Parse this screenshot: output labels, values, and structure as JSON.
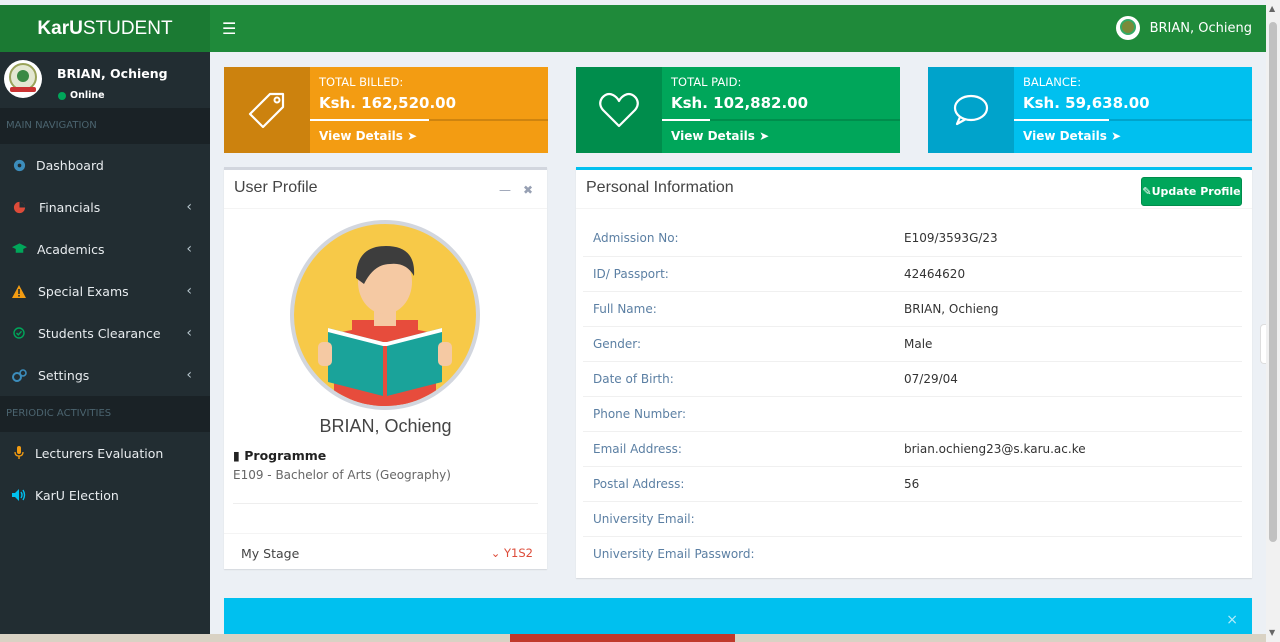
{
  "header": {
    "brand_bold": "KarU",
    "brand_rest": "STUDENT",
    "menu_icon": "hamburger-icon",
    "user_name": "BRIAN, Ochieng"
  },
  "sidebar": {
    "user_name": "BRIAN, Ochieng",
    "status": "Online",
    "main_header": "MAIN NAVIGATION",
    "items": [
      {
        "label": "Dashboard",
        "icon": "dashboard-icon",
        "color": "#3c8dbc"
      },
      {
        "label": "Financials",
        "icon": "pie-chart-icon",
        "color": "#dd4b39"
      },
      {
        "label": "Academics",
        "icon": "graduation-cap-icon",
        "color": "#00a65a"
      },
      {
        "label": "Special Exams",
        "icon": "warning-icon",
        "color": "#f39c12"
      },
      {
        "label": "Students Clearance",
        "icon": "check-circle-icon",
        "color": "#00a65a"
      },
      {
        "label": "Settings",
        "icon": "cogs-icon",
        "color": "#3c8dbc"
      }
    ],
    "periodic_header": "PERIODIC ACTIVITIES",
    "periodic_items": [
      {
        "label": "Lecturers Evaluation",
        "icon": "microphone-icon",
        "color": "#f39c12"
      },
      {
        "label": "KarU Election",
        "icon": "volume-icon",
        "color": "#00c0ef"
      }
    ]
  },
  "info_boxes": [
    {
      "label": "TOTAL BILLED:",
      "amount": "Ksh. 162,520.00",
      "link": "View Details",
      "icon": "tag-icon",
      "color": "#f39c12",
      "progress": 0.5
    },
    {
      "label": "TOTAL PAID:",
      "amount": "Ksh. 102,882.00",
      "link": "View Details",
      "icon": "heart-icon",
      "color": "#00a65a",
      "progress": 0.2
    },
    {
      "label": "BALANCE:",
      "amount": "Ksh. 59,638.00",
      "link": "View Details",
      "icon": "comment-icon",
      "color": "#00c0ef",
      "progress": 0.4
    }
  ],
  "profile": {
    "title": "User Profile",
    "name": "BRIAN, Ochieng",
    "programme_label": "Programme",
    "programme_value": "E109 - Bachelor of Arts (Geography)",
    "stage_label": "My Stage",
    "stage_value": "Y1S2"
  },
  "personal": {
    "title": "Personal Information",
    "update_button": "Update Profile",
    "rows": [
      {
        "key": "Admission No:",
        "value": "E109/3593G/23"
      },
      {
        "key": "ID/ Passport:",
        "value": "42464620"
      },
      {
        "key": "Full Name:",
        "value": "BRIAN, Ochieng"
      },
      {
        "key": "Gender:",
        "value": "Male"
      },
      {
        "key": "Date of Birth:",
        "value": "07/29/04"
      },
      {
        "key": "Phone Number:",
        "value": ""
      },
      {
        "key": "Email Address:",
        "value": "brian.ochieng23@s.karu.ac.ke"
      },
      {
        "key": "Postal Address:",
        "value": "56"
      },
      {
        "key": "University Email:",
        "value": ""
      },
      {
        "key": "University Email Password:",
        "value": ""
      }
    ]
  },
  "callout": {
    "close": "×"
  }
}
